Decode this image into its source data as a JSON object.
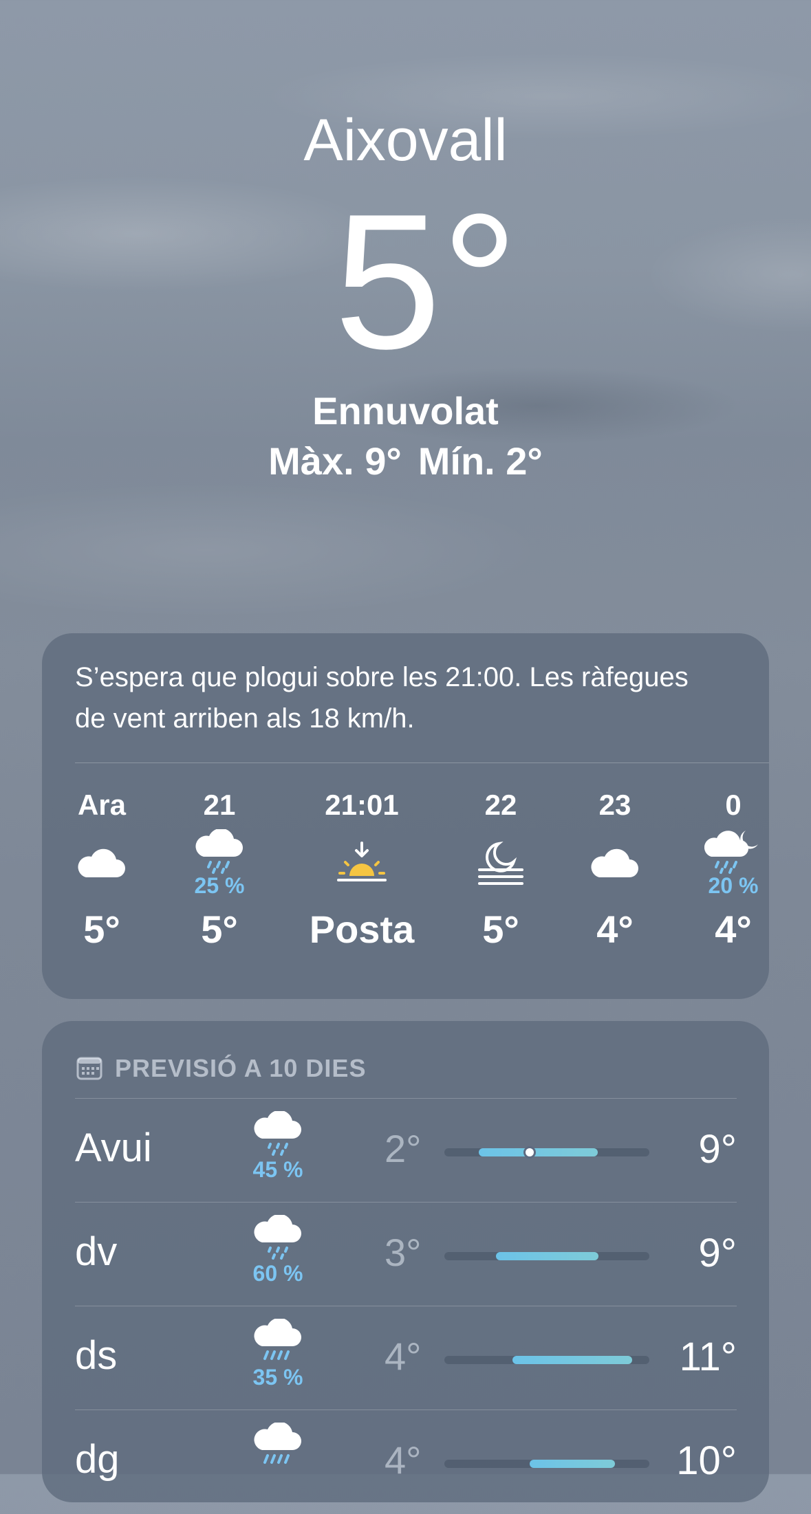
{
  "location": {
    "city": "Aixovall",
    "temperature": "5°",
    "condition": "Ennuvolat",
    "high": "Màx. 9°",
    "low": "Mín. 2°"
  },
  "hourly": {
    "summary": "S’espera que plogui sobre les 21:00. Les ràfegues de vent arriben als 18 km/h.",
    "items": [
      {
        "label": "Ara",
        "icon": "cloud-icon",
        "precip": "",
        "value": "5°"
      },
      {
        "label": "21",
        "icon": "cloud-rain-icon",
        "precip": "25 %",
        "value": "5°"
      },
      {
        "label": "21:01",
        "icon": "sunset-icon",
        "precip": "",
        "value": "Posta"
      },
      {
        "label": "22",
        "icon": "moon-fog-icon",
        "precip": "",
        "value": "5°"
      },
      {
        "label": "23",
        "icon": "cloud-icon",
        "precip": "",
        "value": "4°"
      },
      {
        "label": "0",
        "icon": "cloud-moon-rain-icon",
        "precip": "20 %",
        "value": "4°"
      }
    ]
  },
  "daily": {
    "header": "PREVISIÓ A 10 DIES",
    "days": [
      {
        "day": "Avui",
        "icon": "cloud-drizzle-icon",
        "precip": "45 %",
        "low": "2°",
        "high": "9°",
        "range": [
          2,
          9
        ],
        "current": 5
      },
      {
        "day": "dv",
        "icon": "cloud-drizzle-icon",
        "precip": "60 %",
        "low": "3°",
        "high": "9°",
        "range": [
          3,
          9
        ]
      },
      {
        "day": "ds",
        "icon": "cloud-rain-icon",
        "precip": "35 %",
        "low": "4°",
        "high": "11°",
        "range": [
          4,
          11
        ]
      },
      {
        "day": "dg",
        "icon": "cloud-rain-icon",
        "precip": "",
        "low": "4°",
        "high": "10°",
        "range": [
          5,
          10
        ]
      }
    ],
    "scale": [
      0,
      12
    ]
  },
  "colors": {
    "precip": "#7cc5f2",
    "sun": "#f5c542",
    "bar": "#6cc3e8"
  }
}
